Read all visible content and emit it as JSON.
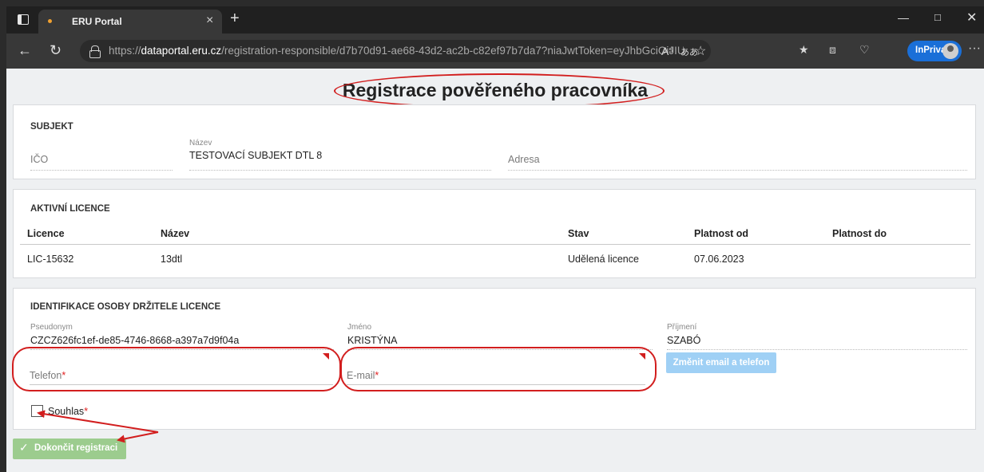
{
  "browser": {
    "tab_title": "ERU Portal",
    "tab_close": "×",
    "new_tab": "+",
    "url_prefix": "https://",
    "url_domain": "dataportal.eru.cz",
    "url_rest": "/registration-responsible/d7b70d91-ae68-43d2-ac2b-c82ef97b7da7?niaJwtToken=eyJhbGciOiJIUz...",
    "read_aloud": "A⁵",
    "translate": "ああ",
    "inprivate_label": "InPrivate",
    "more": "···"
  },
  "page": {
    "title": "Registrace pověřeného pracovníka"
  },
  "subject": {
    "heading": "SUBJEKT",
    "ico_placeholder": "IČO",
    "nazev_label": "Název",
    "nazev_value": "TESTOVACÍ SUBJEKT DTL 8",
    "adresa_placeholder": "Adresa"
  },
  "licences": {
    "heading": "AKTIVNÍ LICENCE",
    "columns": [
      "Licence",
      "Název",
      "Stav",
      "Platnost od",
      "Platnost do"
    ],
    "rows": [
      [
        "LIC-15632",
        "13dtl",
        "Udělená licence",
        "07.06.2023",
        ""
      ]
    ]
  },
  "holder": {
    "heading": "IDENTIFIKACE OSOBY DRŽITELE LICENCE",
    "pseudonym_label": "Pseudonym",
    "pseudonym_value": "CZCZ626fc1ef-de85-4746-8668-a397a7d9f04a",
    "jmeno_label": "Jméno",
    "jmeno_value": "KRISTÝNA",
    "prijmeni_label": "Příjmení",
    "prijmeni_value": "SZABÓ",
    "telefon_placeholder": "Telefon",
    "email_placeholder": "E-mail",
    "required_mark": "*",
    "change_button": "Změnit email a telefon",
    "consent_label": "Souhlas"
  },
  "actions": {
    "finish_button": "Dokončit registraci"
  },
  "colors": {
    "annotation": "#d21e1e",
    "primary_disabled": "#9fd0f5",
    "success_disabled": "#9ccc8e",
    "inprivate": "#1a6fd8"
  }
}
